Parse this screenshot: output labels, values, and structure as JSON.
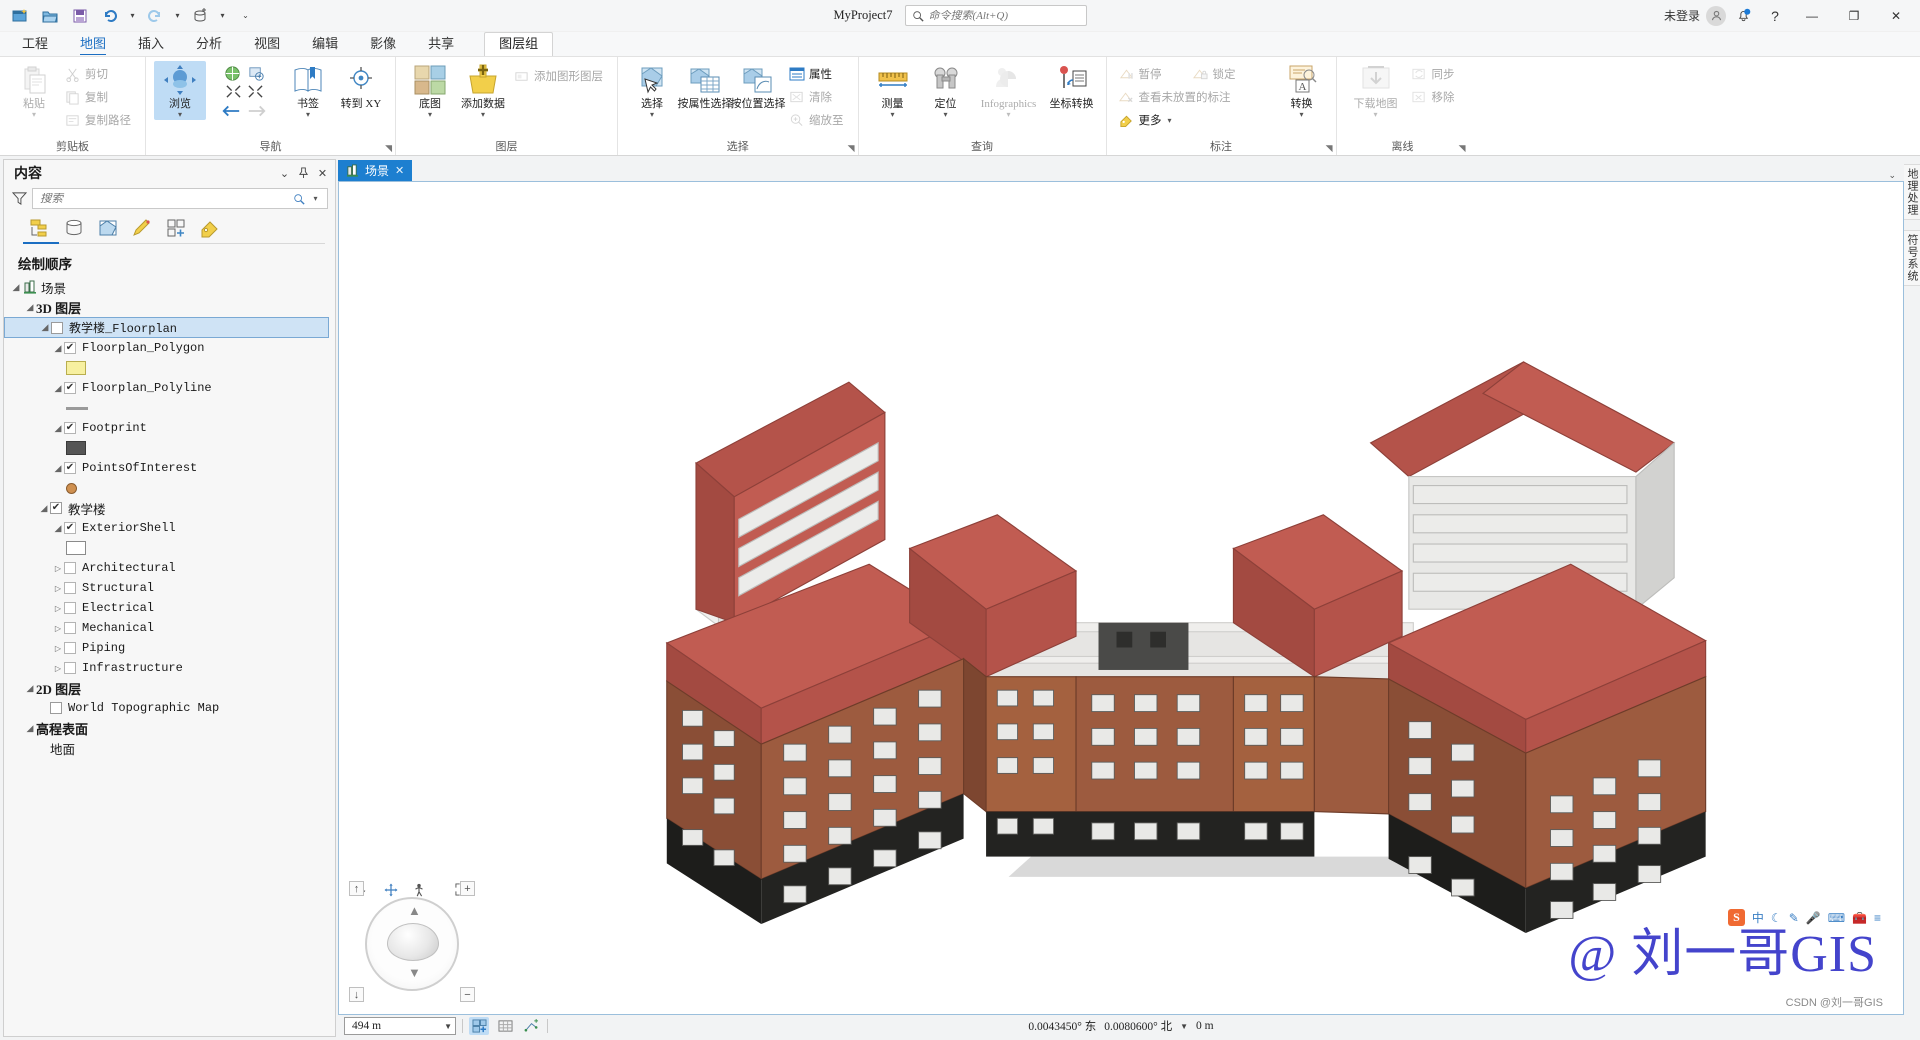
{
  "title_bar": {
    "project_name": "MyProject7",
    "search_placeholder": "命令搜索(Alt+Q)",
    "sign_in": "未登录",
    "qat": [
      {
        "name": "new-project-icon",
        "label": "新建工程"
      },
      {
        "name": "open-project-icon",
        "label": "打开工程"
      },
      {
        "name": "save-project-icon",
        "label": "保存工程"
      },
      {
        "name": "undo-icon",
        "label": "撤消"
      },
      {
        "name": "redo-icon",
        "label": "恢复"
      },
      {
        "name": "add-database-icon",
        "label": "添加数据库"
      },
      {
        "name": "customize-qat-icon",
        "label": "自定义快速访问工具栏"
      }
    ],
    "window_buttons": {
      "minimize": "—",
      "maximize": "❐",
      "close": "✕"
    }
  },
  "ribbon": {
    "tabs": [
      {
        "label": "工程",
        "active": false
      },
      {
        "label": "地图",
        "active": true
      },
      {
        "label": "插入",
        "active": false
      },
      {
        "label": "分析",
        "active": false
      },
      {
        "label": "视图",
        "active": false
      },
      {
        "label": "编辑",
        "active": false
      },
      {
        "label": "影像",
        "active": false
      },
      {
        "label": "共享",
        "active": false
      }
    ],
    "contextual_tab": "图层组",
    "groups": [
      {
        "label": "剪贴板",
        "big": [
          {
            "label": "粘贴",
            "icon": "paste-icon",
            "disabled": true,
            "dropdown": true
          }
        ],
        "small": [
          {
            "label": "剪切",
            "icon": "cut-icon",
            "disabled": true
          },
          {
            "label": "复制",
            "icon": "copy-icon",
            "disabled": true
          },
          {
            "label": "复制路径",
            "icon": "copy-path-icon",
            "disabled": true
          }
        ]
      },
      {
        "label": "导航",
        "big": [
          {
            "label": "浏览",
            "icon": "explore-icon",
            "selected": true,
            "dropdown": true
          },
          {
            "label": "书签",
            "icon": "bookmarks-icon",
            "dropdown": true
          },
          {
            "label": "转到 XY",
            "icon": "go-to-xy-icon"
          }
        ],
        "small": [
          {
            "label": "全图范围",
            "icon": "full-extent-icon"
          },
          {
            "label": "固定缩放",
            "icon": "fixed-zoom-icon"
          },
          {
            "label": "上一范围",
            "icon": "previous-extent-icon"
          },
          {
            "label": "下一范围",
            "icon": "next-extent-icon",
            "disabled": true
          }
        ]
      },
      {
        "label": "图层",
        "big": [
          {
            "label": "底图",
            "icon": "basemap-icon",
            "dropdown": true
          },
          {
            "label": "添加数据",
            "icon": "add-data-icon",
            "dropdown": true
          }
        ],
        "small": [
          {
            "label": "添加图形图层",
            "icon": "add-graphics-layer-icon",
            "disabled": true
          }
        ]
      },
      {
        "label": "选择",
        "big": [
          {
            "label": "选择",
            "icon": "select-icon",
            "dropdown": true
          },
          {
            "label": "按属性选择",
            "icon": "select-by-attributes-icon"
          },
          {
            "label": "按位置选择",
            "icon": "select-by-location-icon"
          }
        ],
        "small": [
          {
            "label": "属性",
            "icon": "attributes-icon"
          },
          {
            "label": "清除",
            "icon": "clear-selection-icon",
            "disabled": true
          },
          {
            "label": "缩放至",
            "icon": "zoom-to-selection-icon",
            "disabled": true
          }
        ]
      },
      {
        "label": "查询",
        "big": [
          {
            "label": "测量",
            "icon": "measure-icon",
            "dropdown": true
          },
          {
            "label": "定位",
            "icon": "locate-icon",
            "dropdown": true
          },
          {
            "label": "Infographics",
            "icon": "infographics-icon",
            "disabled": true,
            "dropdown": true
          },
          {
            "label": "坐标转换",
            "icon": "coordinate-conversion-icon"
          }
        ],
        "small": []
      },
      {
        "label": "标注",
        "big": [
          {
            "label": "转换",
            "icon": "convert-labels-icon",
            "dropdown": true
          }
        ],
        "small": [
          {
            "label": "暂停",
            "icon": "pause-labeling-icon",
            "disabled": true
          },
          {
            "label": "锁定",
            "icon": "lock-labels-icon",
            "disabled": true
          },
          {
            "label": "查看未放置的标注",
            "icon": "view-unplaced-labels-icon",
            "disabled": true
          },
          {
            "label": "更多",
            "icon": "more-labeling-icon",
            "dropdown": true
          }
        ]
      },
      {
        "label": "离线",
        "big": [
          {
            "label": "下载地图",
            "icon": "download-map-icon",
            "disabled": true,
            "dropdown": true
          }
        ],
        "small": [
          {
            "label": "同步",
            "icon": "sync-icon",
            "disabled": true
          },
          {
            "label": "移除",
            "icon": "remove-offline-icon",
            "disabled": true
          }
        ]
      }
    ]
  },
  "contents_pane": {
    "title": "内容",
    "search_placeholder": "搜索",
    "tabs": [
      {
        "name": "drawing-order-tab",
        "icon": "list-by-drawing-order-icon",
        "active": true
      },
      {
        "name": "data-source-tab",
        "icon": "list-by-data-source-icon",
        "active": false
      },
      {
        "name": "selection-tab",
        "icon": "list-by-selection-icon",
        "active": false
      },
      {
        "name": "editing-tab",
        "icon": "list-by-editing-icon",
        "active": false
      },
      {
        "name": "snapping-tab",
        "icon": "list-by-snapping-icon",
        "active": false
      },
      {
        "name": "labeling-tab",
        "icon": "list-by-labeling-icon",
        "active": false
      }
    ],
    "heading": "绘制顺序",
    "tree": [
      {
        "label": "场景",
        "type": "scene",
        "indent": 0,
        "expander": "down",
        "checkbox": "none",
        "icon": "scene-icon",
        "bold": false,
        "font": "cn"
      },
      {
        "label": "3D 图层",
        "type": "group",
        "indent": 1,
        "expander": "down",
        "checkbox": "none",
        "bold": true,
        "font": "cn"
      },
      {
        "label": "教学楼_Floorplan",
        "type": "layer",
        "indent": 2,
        "expander": "down",
        "checkbox": "off",
        "selected": true,
        "font": "mix"
      },
      {
        "label": "Floorplan_Polygon",
        "type": "sublayer",
        "indent": 3,
        "expander": "down",
        "checkbox": "on",
        "font": "mono"
      },
      {
        "label": "",
        "type": "symbol-fill",
        "indent": 4,
        "color": "#f7f0a0",
        "border": "#b9ae4e"
      },
      {
        "label": "Floorplan_Polyline",
        "type": "sublayer",
        "indent": 3,
        "expander": "down",
        "checkbox": "on",
        "font": "mono"
      },
      {
        "label": "",
        "type": "symbol-line",
        "indent": 4,
        "color": "#9a9a9a"
      },
      {
        "label": "Footprint",
        "type": "sublayer",
        "indent": 3,
        "expander": "down",
        "checkbox": "on",
        "font": "mono"
      },
      {
        "label": "",
        "type": "symbol-fill",
        "indent": 4,
        "color": "#555555",
        "border": "#3a3a3a"
      },
      {
        "label": "PointsOfInterest",
        "type": "sublayer",
        "indent": 3,
        "expander": "down",
        "checkbox": "on",
        "font": "mono"
      },
      {
        "label": "",
        "type": "symbol-dot",
        "indent": 4,
        "color": "#cf9050"
      },
      {
        "label": "教学楼",
        "type": "layer",
        "indent": 2,
        "expander": "down",
        "checkbox": "on",
        "font": "cn"
      },
      {
        "label": "ExteriorShell",
        "type": "sublayer",
        "indent": 3,
        "expander": "down",
        "checkbox": "on",
        "font": "mono"
      },
      {
        "label": "",
        "type": "symbol-fill",
        "indent": 4,
        "color": "#ffffff",
        "border": "#8a8a8a"
      },
      {
        "label": "Architectural",
        "type": "sublayer",
        "indent": 3,
        "expander": "right",
        "checkbox": "off",
        "font": "mono"
      },
      {
        "label": "Structural",
        "type": "sublayer",
        "indent": 3,
        "expander": "right",
        "checkbox": "off",
        "font": "mono"
      },
      {
        "label": "Electrical",
        "type": "sublayer",
        "indent": 3,
        "expander": "right",
        "checkbox": "off",
        "font": "mono"
      },
      {
        "label": "Mechanical",
        "type": "sublayer",
        "indent": 3,
        "expander": "right",
        "checkbox": "off",
        "font": "mono"
      },
      {
        "label": "Piping",
        "type": "sublayer",
        "indent": 3,
        "expander": "right",
        "checkbox": "off",
        "font": "mono"
      },
      {
        "label": "Infrastructure",
        "type": "sublayer",
        "indent": 3,
        "expander": "right",
        "checkbox": "off",
        "font": "mono"
      },
      {
        "label": "2D 图层",
        "type": "group",
        "indent": 1,
        "expander": "down",
        "checkbox": "none",
        "bold": true,
        "font": "cn"
      },
      {
        "label": "World Topographic Map",
        "type": "layer",
        "indent": 2,
        "expander": "none",
        "checkbox": "off",
        "font": "mono"
      },
      {
        "label": "高程表面",
        "type": "group",
        "indent": 1,
        "expander": "down",
        "checkbox": "none",
        "bold": true,
        "font": "cn"
      },
      {
        "label": "地面",
        "type": "layer",
        "indent": 2,
        "expander": "none",
        "checkbox": "none",
        "font": "cn"
      }
    ]
  },
  "view": {
    "tab_label": "场景",
    "tab_close": "✕",
    "navigator": {
      "up": "↑",
      "down": "↓",
      "plus": "+",
      "minus": "−"
    }
  },
  "status_bar": {
    "scale": "494 m",
    "coordinates_x": "0.0043450° 东",
    "coordinates_y": "0.0080600° 北",
    "elevation": "0 m"
  },
  "ime_bar": {
    "logo": "S",
    "mode": "中",
    "items": [
      "moon-icon",
      "pen-icon",
      "mic-icon",
      "keyboard-icon",
      "toolbox-icon",
      "menu-icon"
    ]
  },
  "watermark": {
    "text": "@ 刘一哥GIS",
    "credit": "CSDN @刘一哥GIS"
  },
  "right_tabs": [
    {
      "label": "地理处理"
    },
    {
      "label": "符号系统"
    }
  ],
  "colors": {
    "accent": "#1b6ec2",
    "tab_active": "#1d7fd0",
    "selection": "#cfe3f5",
    "roof": "#b4534a",
    "brick": "#9d5b3f"
  }
}
